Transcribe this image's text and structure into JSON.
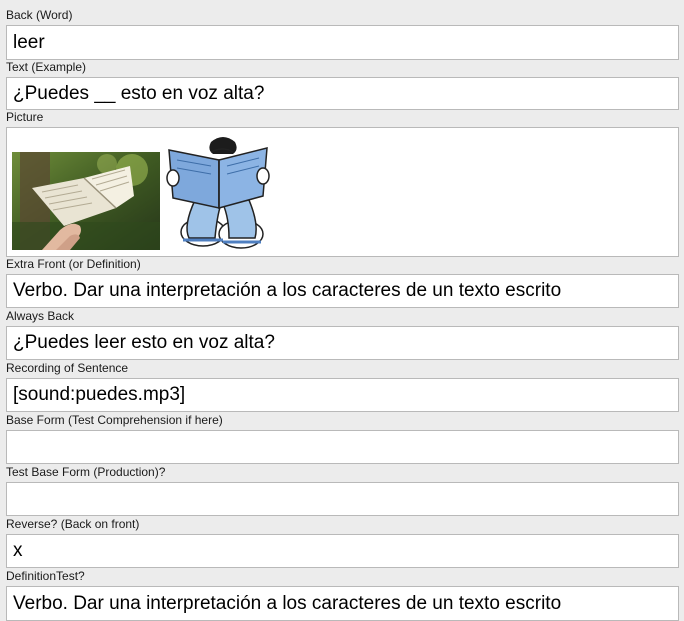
{
  "fields": [
    {
      "label": "Back (Word)",
      "value": "leer"
    },
    {
      "label": "Text (Example)",
      "value": "¿Puedes __ esto en voz alta?"
    },
    {
      "label": "Picture",
      "value": ""
    },
    {
      "label": "Extra Front (or Definition)",
      "value": "Verbo. Dar una interpretación a los caracteres de un texto escrito"
    },
    {
      "label": "Always Back",
      "value": "¿Puedes leer esto en voz alta?"
    },
    {
      "label": "Recording of Sentence",
      "value": "[sound:puedes.mp3]"
    },
    {
      "label": "Base Form (Test Comprehension if here)",
      "value": ""
    },
    {
      "label": "Test Base Form (Production)?",
      "value": ""
    },
    {
      "label": "Reverse? (Back on front)",
      "value": "x"
    },
    {
      "label": "DefinitionTest?",
      "value": "Verbo. Dar una interpretación a los caracteres de un texto escrito"
    }
  ],
  "pictures": [
    "photo-open-book-in-hands",
    "cartoon-child-reading-book"
  ],
  "colors": {
    "background": "#ececec",
    "field_bg": "#ffffff",
    "border": "#b9b9b9"
  }
}
